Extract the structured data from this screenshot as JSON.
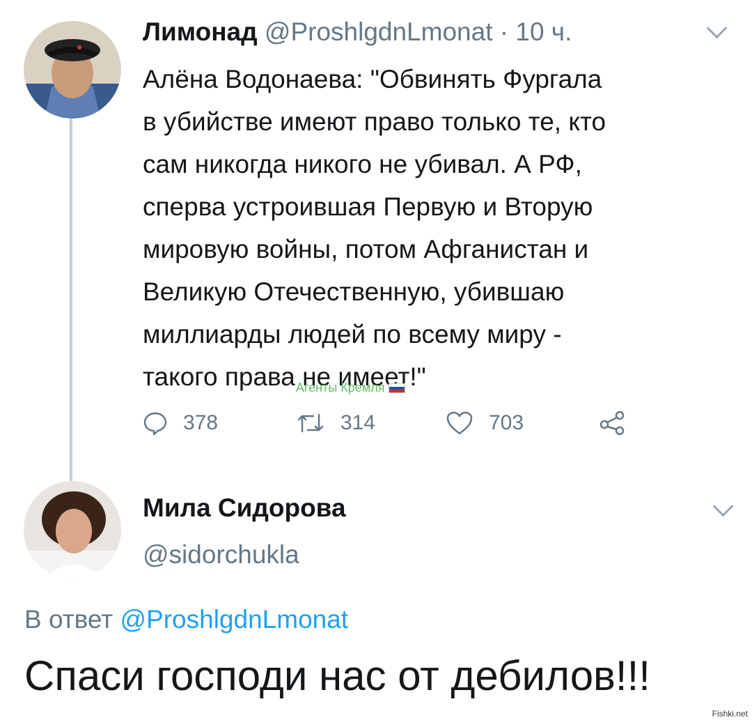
{
  "tweet1": {
    "author_name": "Лимонад",
    "handle": "@ProshlgdnLmonat",
    "time": "· 10 ч.",
    "text_lines": [
      "Алёна Водонаева: \"Обвинять Фургала",
      "в убийстве имеют право только те, кто",
      "сам никогда никого не убивал. А РФ,",
      "сперва устроившая Первую и Вторую",
      "мировую войны, потом Афганистан и",
      "Великую Отечественную, убившаю",
      "миллиарды людей по всему миру -",
      "такого права не имеет!\""
    ],
    "replies": "378",
    "retweets": "314",
    "likes": "703"
  },
  "overlay_label": "Агенты Кремля",
  "tweet2": {
    "author_name": "Мила Сидорова",
    "handle": "@sidorchukla",
    "reply_prefix": "В ответ",
    "reply_handle": "@ProshlgdnLmonat",
    "text": "Спаси господи нас от дебилов!!!"
  },
  "watermark": "Fishki.net",
  "icons": {
    "reply": "reply-icon",
    "retweet": "retweet-icon",
    "like": "like-icon",
    "share": "share-icon",
    "chevron": "chevron-down-icon"
  },
  "colors": {
    "text": "#14171a",
    "muted": "#657786",
    "link": "#1da1f2",
    "agents_label": "#66bb66"
  }
}
